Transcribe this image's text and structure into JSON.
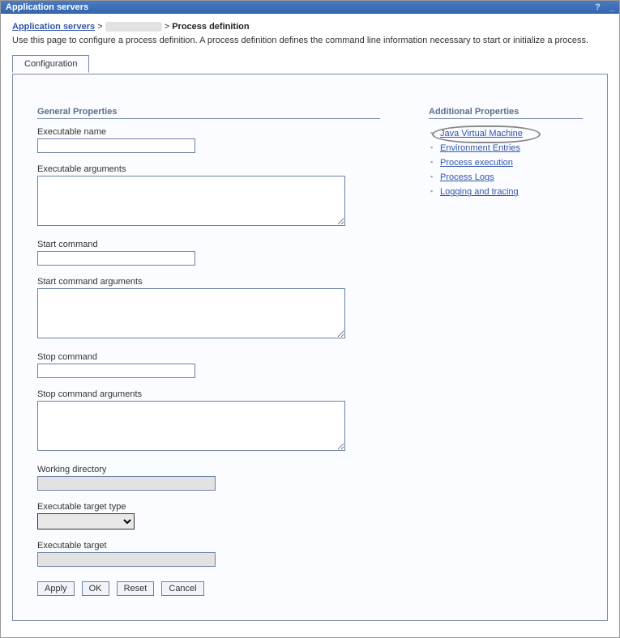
{
  "window": {
    "title": "Application servers"
  },
  "breadcrumb": {
    "root_label": "Application servers",
    "arrow": ">",
    "current_label": "Process definition"
  },
  "description": "Use this page to configure a process definition. A process definition defines the command line information necessary to start or initialize a process.",
  "tabs": {
    "configuration": "Configuration"
  },
  "general": {
    "title": "General Properties",
    "fields": {
      "executable_name_label": "Executable name",
      "executable_name_value": "",
      "executable_arguments_label": "Executable arguments",
      "executable_arguments_value": "",
      "start_command_label": "Start command",
      "start_command_value": "",
      "start_command_args_label": "Start command arguments",
      "start_command_args_value": "",
      "stop_command_label": "Stop command",
      "stop_command_value": "",
      "stop_command_args_label": "Stop command arguments",
      "stop_command_args_value": "",
      "working_directory_label": "Working directory",
      "working_directory_value": "",
      "executable_target_type_label": "Executable target type",
      "executable_target_type_value": "",
      "executable_target_label": "Executable target",
      "executable_target_value": ""
    }
  },
  "additional": {
    "title": "Additional Properties",
    "links": {
      "jvm": "Java Virtual Machine",
      "env": "Environment Entries",
      "process_exec": "Process execution",
      "process_logs": "Process Logs",
      "logging_tracing": "Logging and tracing"
    }
  },
  "buttons": {
    "apply": "Apply",
    "ok": "OK",
    "reset": "Reset",
    "cancel": "Cancel"
  }
}
